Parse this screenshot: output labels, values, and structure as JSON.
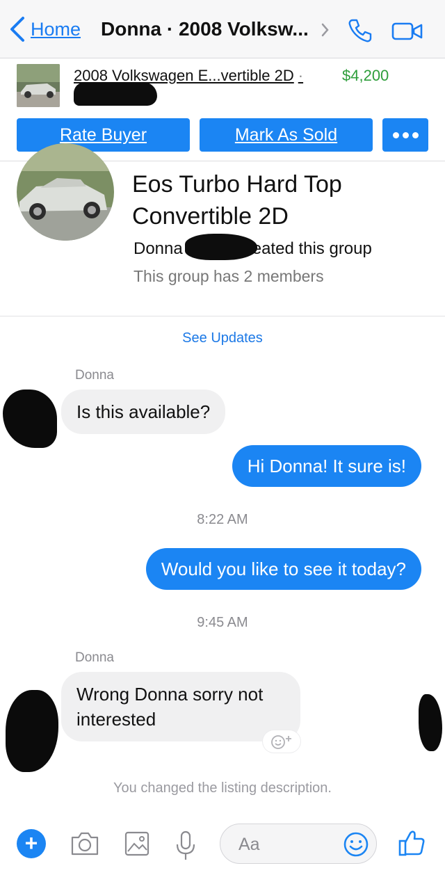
{
  "nav": {
    "back_label": "Home",
    "title": "Donna · 2008 Volksw...",
    "accent": "#1a7cf2"
  },
  "listing": {
    "title": "2008 Volkswagen E...vertible 2D",
    "separator": "·",
    "price": "$4,200",
    "price_color": "#2e9e3b",
    "rate_buyer_label": "Rate Buyer",
    "mark_sold_label": "Mark As Sold",
    "more_icon": "more-dots-icon"
  },
  "group": {
    "name": "Eos Turbo Hard Top Convertible 2D",
    "creator_first": "Donna",
    "created_text": "created this group",
    "members": "This group has 2 members",
    "see_updates": "See Updates"
  },
  "messages": [
    {
      "sender": "Donna",
      "direction": "incoming",
      "text": "Is this available?"
    },
    {
      "direction": "outgoing",
      "text": "Hi Donna! It sure is!"
    },
    {
      "type": "timestamp",
      "text": "8:22 AM"
    },
    {
      "direction": "outgoing",
      "text": "Would you like to see it today?"
    },
    {
      "type": "timestamp",
      "text": "9:45 AM"
    },
    {
      "sender": "Donna",
      "direction": "incoming",
      "text": "Wrong Donna sorry not interested"
    }
  ],
  "system_message": "You changed the listing description.",
  "composer": {
    "placeholder": "Aa",
    "icons": [
      "plus-icon",
      "camera-icon",
      "image-icon",
      "microphone-icon",
      "emoji-icon",
      "thumbs-up-icon"
    ]
  },
  "colors": {
    "brand_blue": "#1b85f3",
    "incoming_bubble": "#f0f0f1"
  }
}
